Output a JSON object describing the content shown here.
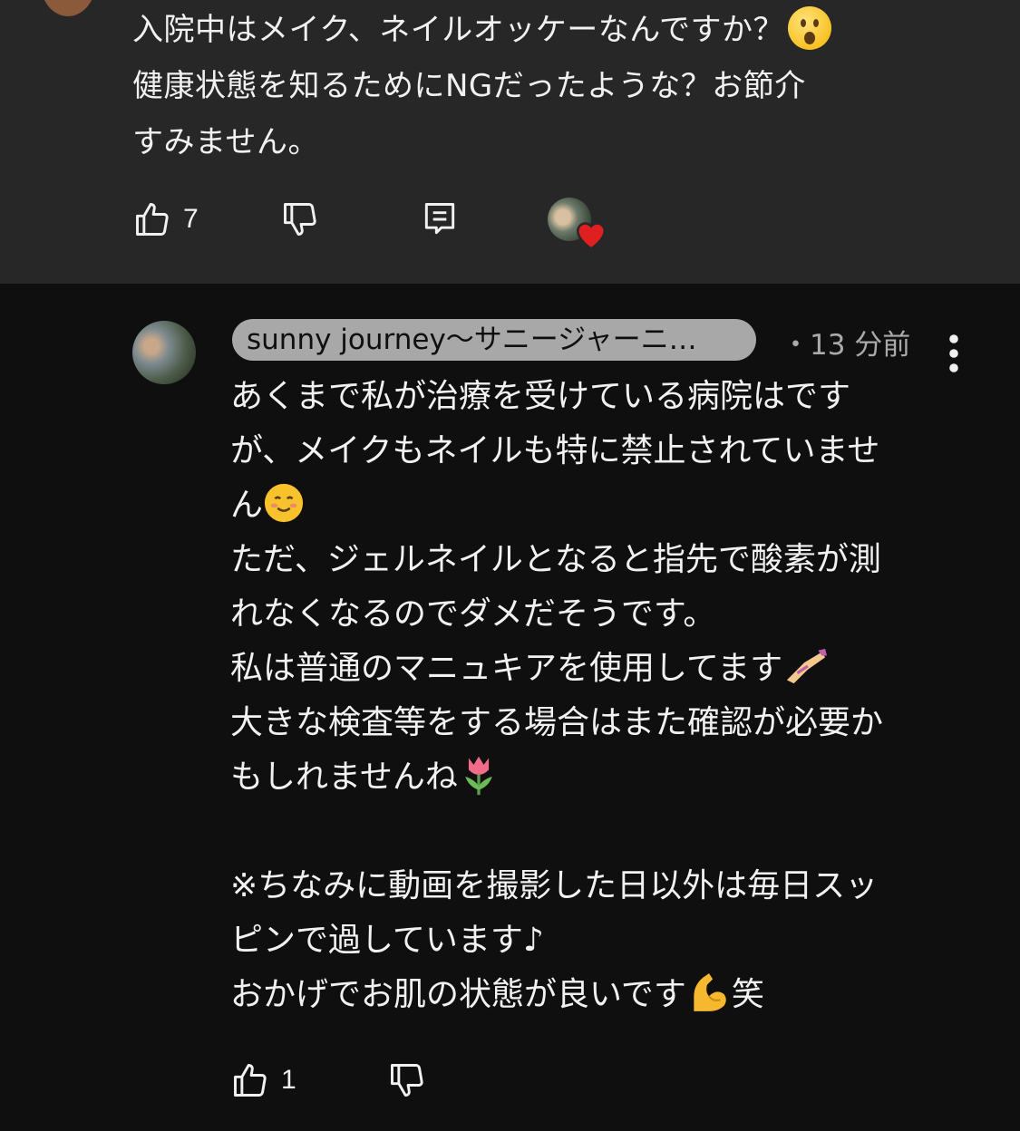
{
  "top_comment": {
    "lines": [
      "入院中はメイク、ネイルオッケーなんですか？",
      "健康状態を知るためにNGだったような？お節介",
      "すみません。"
    ],
    "like_count": "7",
    "icons": [
      "thumbs-up-icon",
      "thumbs-down-icon",
      "reply-icon",
      "creator-heart-icon"
    ]
  },
  "reply": {
    "author": "sunny journey～サニージャーニ…",
    "timestamp": "・13 分前",
    "lines": [
      "あくまで私が治療を受けている病院はです",
      "が、メイクもネイルも特に禁止されていませ",
      "ん",
      "ただ、ジェルネイルとなると指先で酸素が測",
      "れなくなるのでダメだそうです。",
      "私は普通のマニュキアを使用してます",
      "大きな検査等をする場合はまた確認が必要か",
      "もしれませんね",
      "",
      "※ちなみに動画を撮影した日以外は毎日スッ",
      "ピンで過しています♪",
      "おかげでお肌の状態が良いです",
      "笑"
    ],
    "like_count": "1",
    "icons": [
      "thumbs-up-icon",
      "thumbs-down-icon",
      "more-vertical-icon"
    ]
  },
  "colors": {
    "top_background": "#272727",
    "page_background": "#0f0f0f",
    "author_chip": "#a8a8a8",
    "secondary_text": "#aaaaaa",
    "heart": "#e02020"
  }
}
